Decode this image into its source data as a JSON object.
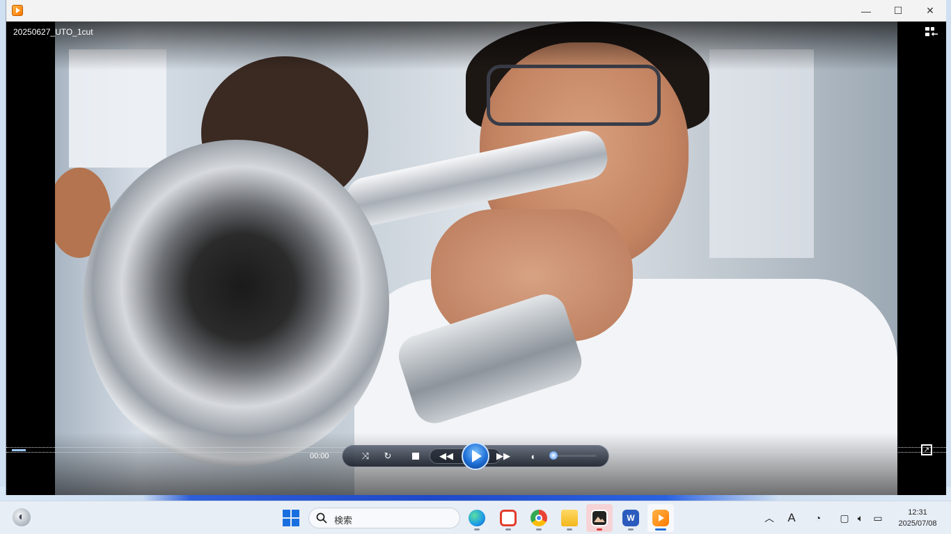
{
  "window": {
    "title": "",
    "controls": {
      "minimize": "—",
      "maximize": "☐",
      "close": "✕"
    }
  },
  "player": {
    "video_title": "20250627_UTO_1cut",
    "time": "00:00",
    "seek_progress": 0.015,
    "volume_level": 0.15,
    "icons": {
      "switch_view": "switch-to-library-icon",
      "shuffle": "shuffle-icon",
      "repeat": "repeat-icon",
      "stop": "stop-icon",
      "previous": "previous-icon",
      "play": "play-icon",
      "next": "next-icon",
      "mute": "speaker-icon",
      "fullscreen": "fullscreen-icon"
    }
  },
  "taskbar": {
    "search_placeholder": "検索",
    "apps": [
      {
        "name": "edge",
        "icon": "edge-icon",
        "color": "#1c9be8",
        "active": false
      },
      {
        "name": "adobe-acrobat",
        "icon": "acrobat-icon",
        "color": "#e33c2c",
        "active": false
      },
      {
        "name": "chrome",
        "icon": "chrome-icon",
        "color": "#34a853",
        "active": false
      },
      {
        "name": "file-explorer",
        "icon": "folder-icon",
        "color": "#f3c23b",
        "active": false
      },
      {
        "name": "photos",
        "icon": "photos-icon",
        "color": "#2f2f2f",
        "active": false
      },
      {
        "name": "word",
        "icon": "word-icon",
        "color": "#2b5bbd",
        "active": false
      },
      {
        "name": "media-player",
        "icon": "media-player-icon",
        "color": "#ff8a00",
        "active": true
      }
    ],
    "tray": {
      "clock_time": "12:31",
      "clock_date": "2025/07/08",
      "ime": "A"
    }
  }
}
